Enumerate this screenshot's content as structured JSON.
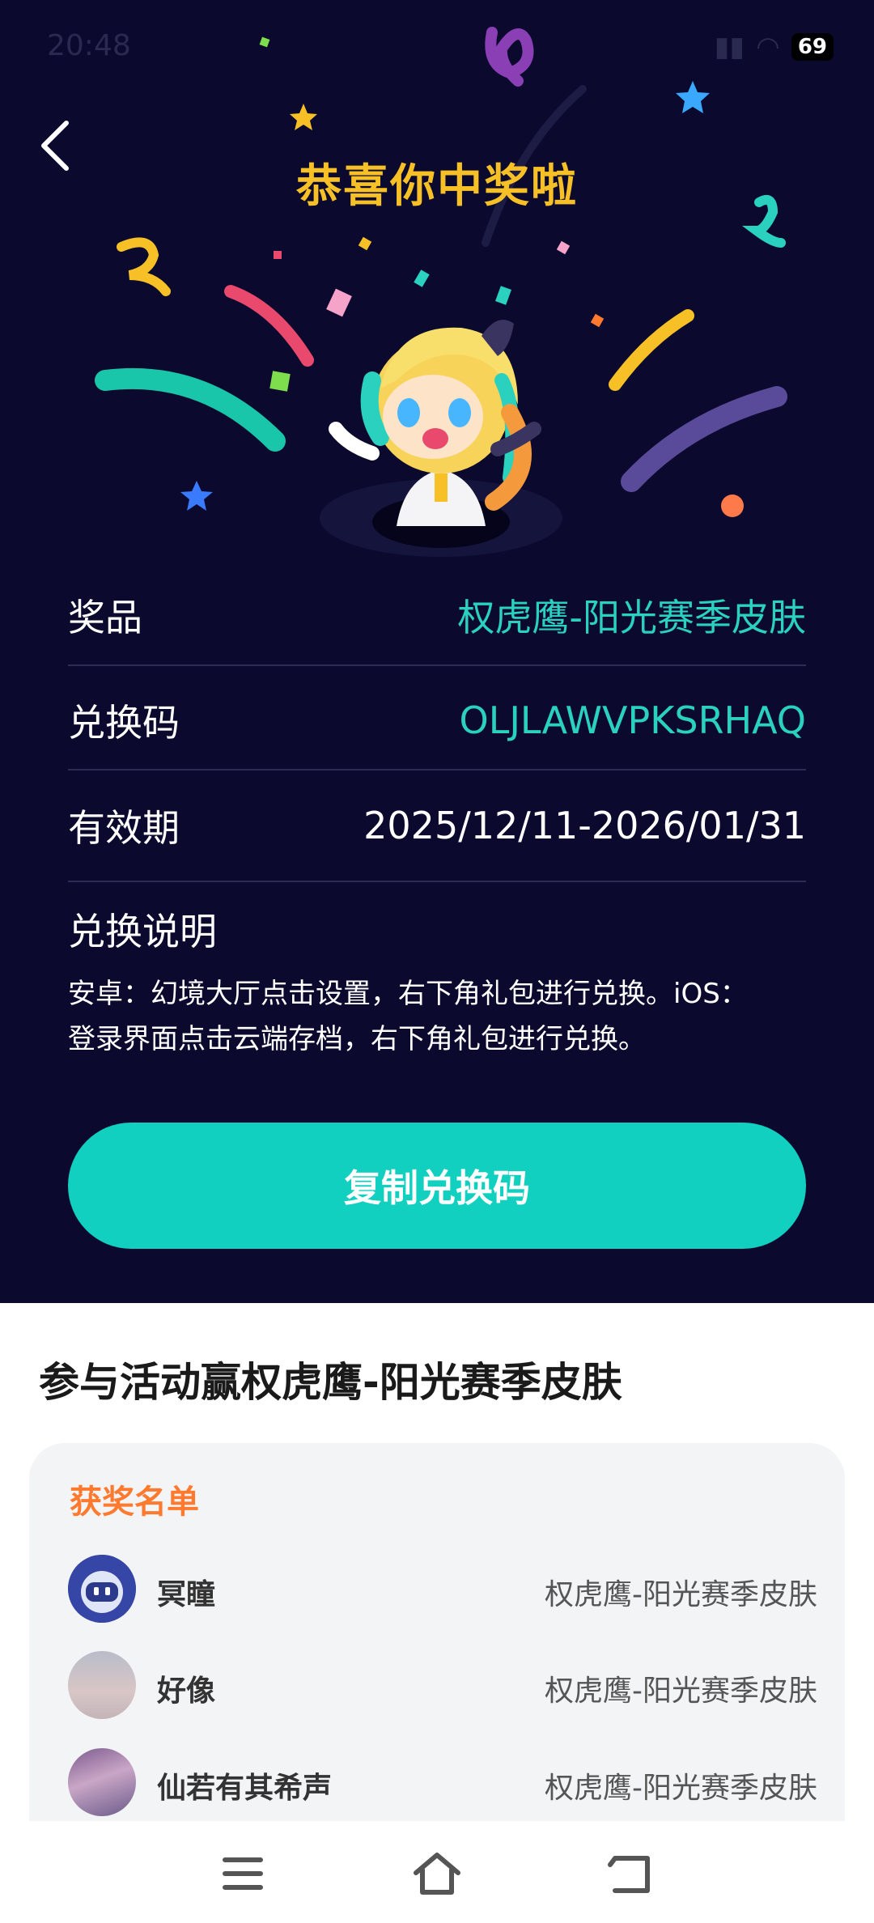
{
  "status_bar": {
    "time": "20:48",
    "battery": "69"
  },
  "header": {
    "title": "恭喜你中奖啦"
  },
  "prize": {
    "prize_label": "奖品",
    "prize_value": "权虎鹰-阳光赛季皮肤",
    "code_label": "兑换码",
    "code_value": "OLJLAWVPKSRHAQ",
    "validity_label": "有效期",
    "validity_value": "2025/12/11-2026/01/31",
    "instructions_title": "兑换说明",
    "instructions_line1": "安卓：幻境大厅点击设置，右下角礼包进行兑换。iOS：",
    "instructions_line2": "登录界面点击云端存档，右下角礼包进行兑换。"
  },
  "copy_button": {
    "label": "复制兑换码"
  },
  "activity": {
    "title": "参与活动赢权虎鹰-阳光赛季皮肤"
  },
  "winners": {
    "title": "获奖名单",
    "items": [
      {
        "name": "冥瞳",
        "prize": "权虎鹰-阳光赛季皮肤"
      },
      {
        "name": "好像",
        "prize": "权虎鹰-阳光赛季皮肤"
      },
      {
        "name": "仙若有其希声",
        "prize": "权虎鹰-阳光赛季皮肤"
      }
    ]
  },
  "colors": {
    "background": "#0b0a2e",
    "accent": "#12d0bf",
    "title": "#f6c026",
    "winners_title": "#ff7a2f"
  },
  "icons": {
    "back": "back-arrow-icon",
    "menu": "menu-icon",
    "home": "home-icon",
    "return": "return-icon"
  }
}
